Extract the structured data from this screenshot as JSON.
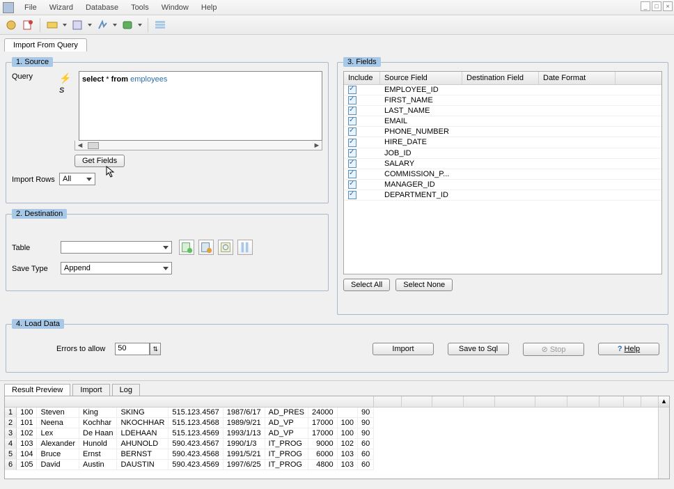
{
  "menu": {
    "file": "File",
    "wizard": "Wizard",
    "database": "Database",
    "tools": "Tools",
    "window": "Window",
    "help": "Help"
  },
  "tabs": {
    "import_from_query": "Import From Query"
  },
  "source": {
    "legend": "1. Source",
    "query_label": "Query",
    "query_text": "select * from employees",
    "get_fields": "Get Fields",
    "import_rows_label": "Import Rows",
    "import_rows_value": "All"
  },
  "destination": {
    "legend": "2. Destination",
    "table_label": "Table",
    "table_value": "",
    "save_type_label": "Save Type",
    "save_type_value": "Append"
  },
  "fields": {
    "legend": "3. Fields",
    "cols": {
      "include": "Include",
      "source": "Source Field",
      "dest": "Destination Field",
      "fmt": "Date Format"
    },
    "rows": [
      {
        "src": "EMPLOYEE_ID"
      },
      {
        "src": "FIRST_NAME"
      },
      {
        "src": "LAST_NAME"
      },
      {
        "src": "EMAIL"
      },
      {
        "src": "PHONE_NUMBER"
      },
      {
        "src": "HIRE_DATE"
      },
      {
        "src": "JOB_ID"
      },
      {
        "src": "SALARY"
      },
      {
        "src": "COMMISSION_P..."
      },
      {
        "src": "MANAGER_ID"
      },
      {
        "src": "DEPARTMENT_ID"
      }
    ],
    "select_all": "Select All",
    "select_none": "Select None"
  },
  "load": {
    "legend": "4. Load Data",
    "errors_label": "Errors to allow",
    "errors_value": "50",
    "import": "Import",
    "save_sql": "Save to Sql",
    "stop": "Stop",
    "help": "Help"
  },
  "bottom_tabs": {
    "preview": "Result Preview",
    "import": "Import",
    "log": "Log"
  },
  "result": {
    "rows": [
      {
        "n": "1",
        "id": "100",
        "fn": "Steven",
        "ln": "King",
        "em": "SKING",
        "ph": "515.123.4567",
        "dt": "1987/6/17",
        "job": "AD_PRES",
        "sal": "24000",
        "c1": "",
        "c2": "90"
      },
      {
        "n": "2",
        "id": "101",
        "fn": "Neena",
        "ln": "Kochhar",
        "em": "NKOCHHAR",
        "ph": "515.123.4568",
        "dt": "1989/9/21",
        "job": "AD_VP",
        "sal": "17000",
        "c1": "100",
        "c2": "90"
      },
      {
        "n": "3",
        "id": "102",
        "fn": "Lex",
        "ln": "De Haan",
        "em": "LDEHAAN",
        "ph": "515.123.4569",
        "dt": "1993/1/13",
        "job": "AD_VP",
        "sal": "17000",
        "c1": "100",
        "c2": "90"
      },
      {
        "n": "4",
        "id": "103",
        "fn": "Alexander",
        "ln": "Hunold",
        "em": "AHUNOLD",
        "ph": "590.423.4567",
        "dt": "1990/1/3",
        "job": "IT_PROG",
        "sal": "9000",
        "c1": "102",
        "c2": "60"
      },
      {
        "n": "5",
        "id": "104",
        "fn": "Bruce",
        "ln": "Ernst",
        "em": "BERNST",
        "ph": "590.423.4568",
        "dt": "1991/5/21",
        "job": "IT_PROG",
        "sal": "6000",
        "c1": "103",
        "c2": "60"
      },
      {
        "n": "6",
        "id": "105",
        "fn": "David",
        "ln": "Austin",
        "em": "DAUSTIN",
        "ph": "590.423.4569",
        "dt": "1997/6/25",
        "job": "IT_PROG",
        "sal": "4800",
        "c1": "103",
        "c2": "60"
      }
    ]
  }
}
